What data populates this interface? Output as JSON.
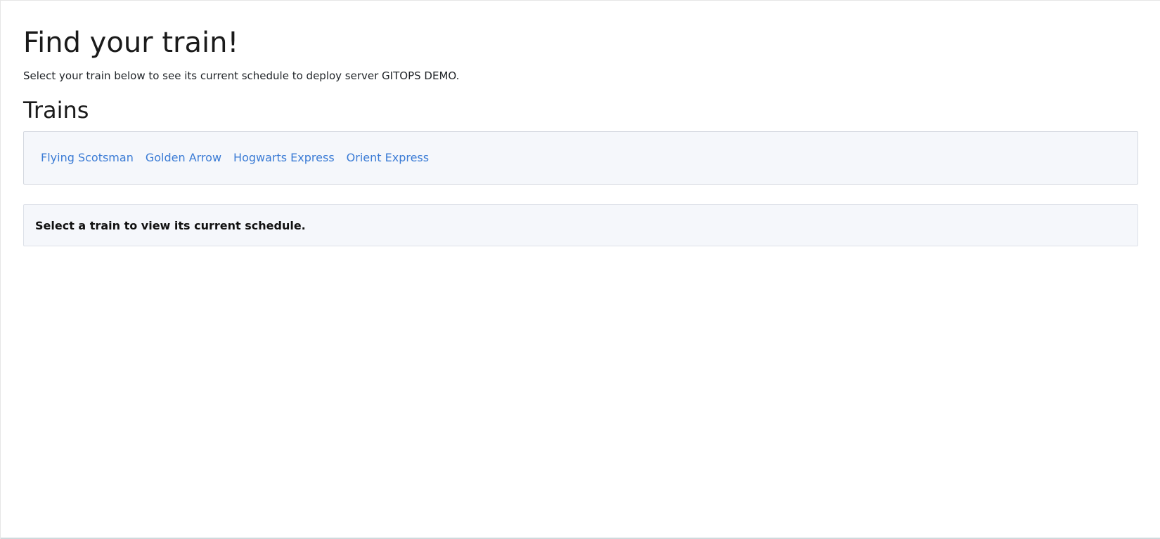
{
  "header": {
    "title": "Find your train!",
    "subtitle": "Select your train below to see its current schedule to deploy server GITOPS DEMO."
  },
  "trains": {
    "heading": "Trains",
    "items": [
      {
        "label": "Flying Scotsman"
      },
      {
        "label": "Golden Arrow"
      },
      {
        "label": "Hogwarts Express"
      },
      {
        "label": "Orient Express"
      }
    ]
  },
  "schedule": {
    "message": "Select a train to view its current schedule."
  },
  "colors": {
    "link": "#3a7bd5",
    "panel_background": "#f5f7fb",
    "panel_border": "#d4d8e0",
    "text": "#212529"
  }
}
